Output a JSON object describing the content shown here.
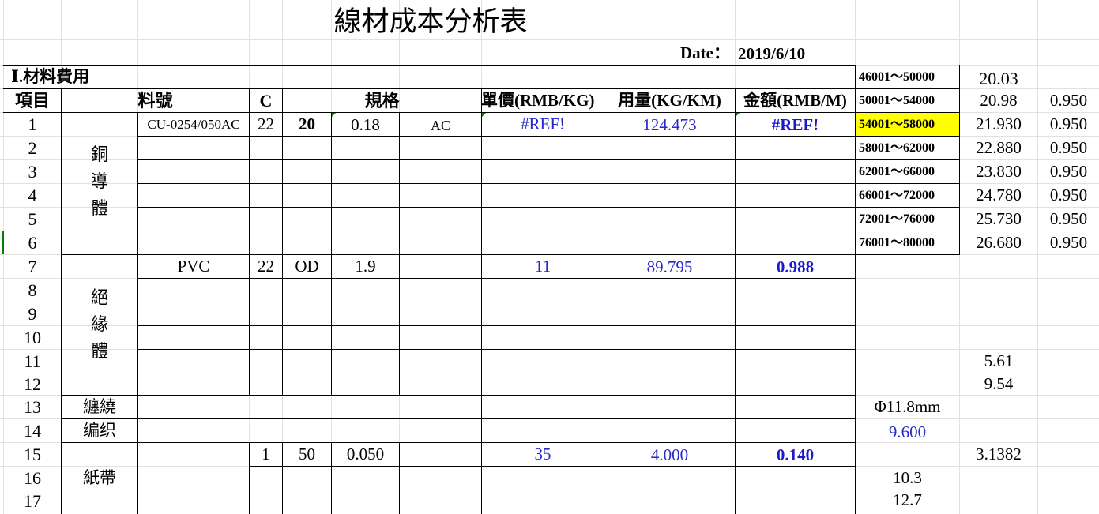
{
  "title": "線材成本分析表",
  "date_label": "Date：",
  "date_value": "2019/6/10",
  "section_label": "Ⅰ.材料費用",
  "headers": {
    "item": "項目",
    "part_no": "料號",
    "c": "C",
    "spec": "規格",
    "unit_price": "單價(RMB/KG)",
    "usage": "用量(KG/KM)",
    "amount": "金額(RMB/M)"
  },
  "row_numbers": [
    "1",
    "2",
    "3",
    "4",
    "5",
    "6",
    "7",
    "8",
    "9",
    "10",
    "11",
    "12",
    "13",
    "14",
    "15",
    "16",
    "17"
  ],
  "groups": {
    "copper": [
      "銅",
      "導",
      "體"
    ],
    "insulation": [
      "絕",
      "緣",
      "體"
    ],
    "wrap": "纏繞",
    "braid": "编织",
    "paper": "紙帶"
  },
  "rows": {
    "r1": {
      "part_no": "CU-0254/050AC",
      "c": "22",
      "spec1": "20",
      "spec2": "0.18",
      "spec3": "AC",
      "unit_price": "#REF!",
      "usage": "124.473",
      "amount": "#REF!"
    },
    "r7": {
      "part_no": "PVC",
      "c": "22",
      "spec1": "OD",
      "spec2": "1.9",
      "unit_price": "11",
      "usage": "89.795",
      "amount": "0.988"
    },
    "r15": {
      "c": "1",
      "spec1": "50",
      "spec2": "0.050",
      "unit_price": "35",
      "usage": "4.000",
      "amount": "0.140"
    }
  },
  "price_ranges": [
    {
      "range": "46001～50000",
      "price": "20.03",
      "factor": ""
    },
    {
      "range": "50001～54000",
      "price": "20.98",
      "factor": "0.950"
    },
    {
      "range": "54001～58000",
      "price": "21.930",
      "factor": "0.950"
    },
    {
      "range": "58001～62000",
      "price": "22.880",
      "factor": "0.950"
    },
    {
      "range": "62001～66000",
      "price": "23.830",
      "factor": "0.950"
    },
    {
      "range": "66001～72000",
      "price": "24.780",
      "factor": "0.950"
    },
    {
      "range": "72001～76000",
      "price": "25.730",
      "factor": "0.950"
    },
    {
      "range": "76001～80000",
      "price": "26.680",
      "factor": "0.950"
    }
  ],
  "side_values": {
    "v_5_61": "5.61",
    "v_9_54": "9.54",
    "phi": "Φ11.8mm",
    "v_9_600": "9.600",
    "v_3_1382": "3.1382",
    "v_10_3": "10.3",
    "v_12_7": "12.7"
  },
  "colors": {
    "highlight": "#ffff00",
    "value_blue": "#2a2acc",
    "marker_green": "#008000"
  }
}
